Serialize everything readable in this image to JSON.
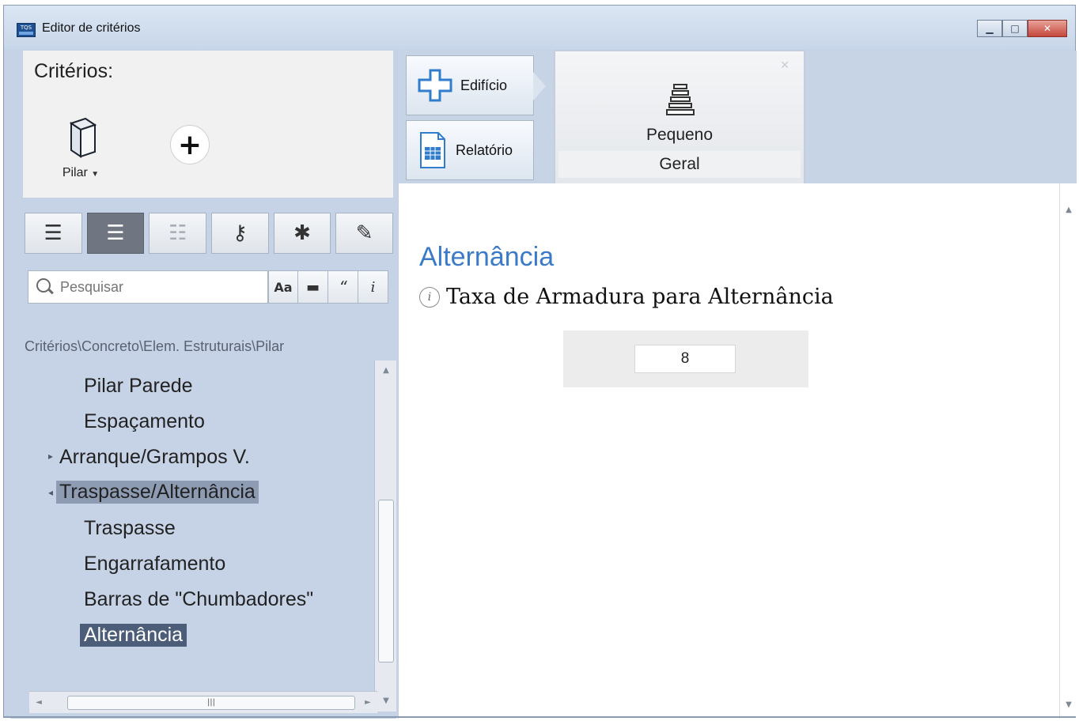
{
  "window": {
    "title": "Editor de critérios",
    "app_icon_text": "TQS"
  },
  "left": {
    "criteria_label": "Critérios:",
    "pilar_label": "Pilar",
    "add_symbol": "+",
    "search_placeholder": "Pesquisar",
    "breadcrumb": "Critérios\\Concreto\\Elem. Estruturais\\Pilar",
    "tree": [
      "Pilar Parede",
      "Espaçamento",
      "Arranque/Grampos V.",
      "Traspasse/Alternância",
      "Traspasse",
      "Engarrafamento",
      "Barras de \"Chumbadores\"",
      "Alternância"
    ],
    "toolbar_icons": [
      "list-icon",
      "tree-icon",
      "details-icon",
      "key-icon",
      "asterisk-icon",
      "pencil-icon"
    ],
    "toggles": {
      "arranque": "▸",
      "traspasse": "◂"
    }
  },
  "right": {
    "nav": {
      "building_label": "Edifício",
      "report_label": "Relatório"
    },
    "tab": {
      "size_label": "Pequeno",
      "category_label": "Geral"
    },
    "section_title": "Alternância",
    "info_icon_text": "i",
    "parameter_label": "Taxa de Armadura para Alternância",
    "parameter_value": "8"
  },
  "colors": {
    "accent_blue": "#3a7ac8",
    "selected_bg": "#4b5d79",
    "highlight_bg": "#8d9bb3",
    "panel_bg": "#c6d3e6"
  }
}
